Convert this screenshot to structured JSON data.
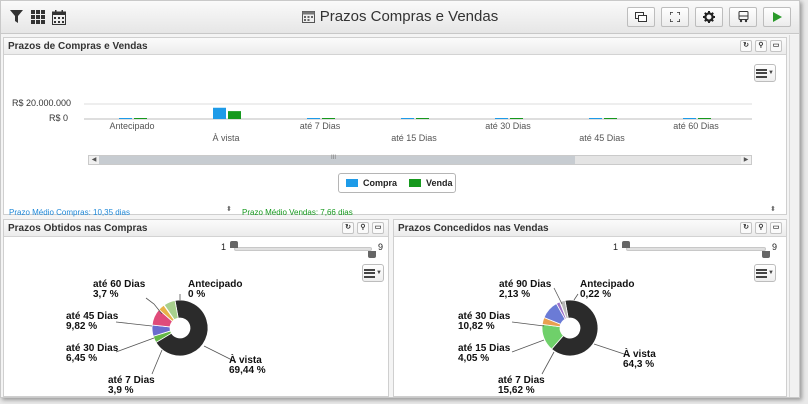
{
  "window": {
    "title": "Prazos Compras e Vendas"
  },
  "toolbar": {
    "left_icons": [
      "filter-icon",
      "grid-icon",
      "calendar-icon"
    ],
    "right_buttons": [
      "window-icon",
      "fullscreen-icon",
      "gear-icon",
      "bus-icon",
      "play-icon"
    ]
  },
  "panel_top": {
    "title": "Prazos de Compras e Vendas",
    "y_ticks": [
      "R$ 20.000.000",
      "R$ 0"
    ],
    "legend": [
      "Compra",
      "Venda"
    ],
    "avg_compras": "Prazo Médio Compras: 10,35 dias",
    "avg_vendas": "Prazo Médio Vendas: 7,66 dias",
    "scroll_mark": "III"
  },
  "chart_data": {
    "type": "bar",
    "categories": [
      "Antecipado",
      "À vista",
      "até 7 Dias",
      "até 15 Dias",
      "até 30 Dias",
      "até 45 Dias",
      "até 60 Dias"
    ],
    "series": [
      {
        "name": "Compra",
        "values": [
          0,
          15000000,
          0,
          0,
          0,
          400000,
          0
        ]
      },
      {
        "name": "Venda",
        "values": [
          0,
          10500000,
          400000,
          0,
          400000,
          0,
          0
        ]
      }
    ],
    "ylim": [
      0,
      20000000
    ],
    "colors": {
      "Compra": "#1e9be8",
      "Venda": "#16991e"
    }
  },
  "panel_compras": {
    "title": "Prazos Obtidos nas Compras",
    "slider_min": "1",
    "slider_max": "9",
    "slices": [
      {
        "label": "À vista",
        "pct": "69,44 %",
        "value": 69.44,
        "color": "#2b2b2b"
      },
      {
        "label": "até 7 Dias",
        "pct": "3,9 %",
        "value": 3.9,
        "color": "#64b748"
      },
      {
        "label": "até 30 Dias",
        "pct": "6,45 %",
        "value": 6.45,
        "color": "#6b6bcf"
      },
      {
        "label": "até 45 Dias",
        "pct": "9,82 %",
        "value": 9.82,
        "color": "#e04b7a"
      },
      {
        "label": "até 60 Dias",
        "pct": "3,7 %",
        "value": 3.7,
        "color": "#e8b248"
      },
      {
        "label": "Antecipado",
        "pct": "0 %",
        "value": 0.3,
        "color": "#4aa3e8"
      },
      {
        "label": "",
        "pct": "",
        "value": 6.69,
        "color": "#a8d08d"
      }
    ]
  },
  "panel_vendas": {
    "title": "Prazos Concedidos nas Vendas",
    "slider_min": "1",
    "slider_max": "9",
    "slices": [
      {
        "label": "À vista",
        "pct": "64,3 %",
        "value": 64.3,
        "color": "#2b2b2b"
      },
      {
        "label": "até 7 Dias",
        "pct": "15,62 %",
        "value": 15.62,
        "color": "#6fd06a"
      },
      {
        "label": "até 15 Dias",
        "pct": "4,05 %",
        "value": 4.05,
        "color": "#e8a050"
      },
      {
        "label": "até 30 Dias",
        "pct": "10,82 %",
        "value": 10.82,
        "color": "#6b7bd6"
      },
      {
        "label": "até 90 Dias",
        "pct": "2,13 %",
        "value": 2.13,
        "color": "#9c70c8"
      },
      {
        "label": "Antecipado",
        "pct": "0,22 %",
        "value": 0.22,
        "color": "#4aa3e8"
      },
      {
        "label": "",
        "pct": "",
        "value": 2.86,
        "color": "#b8b8b8"
      }
    ]
  }
}
